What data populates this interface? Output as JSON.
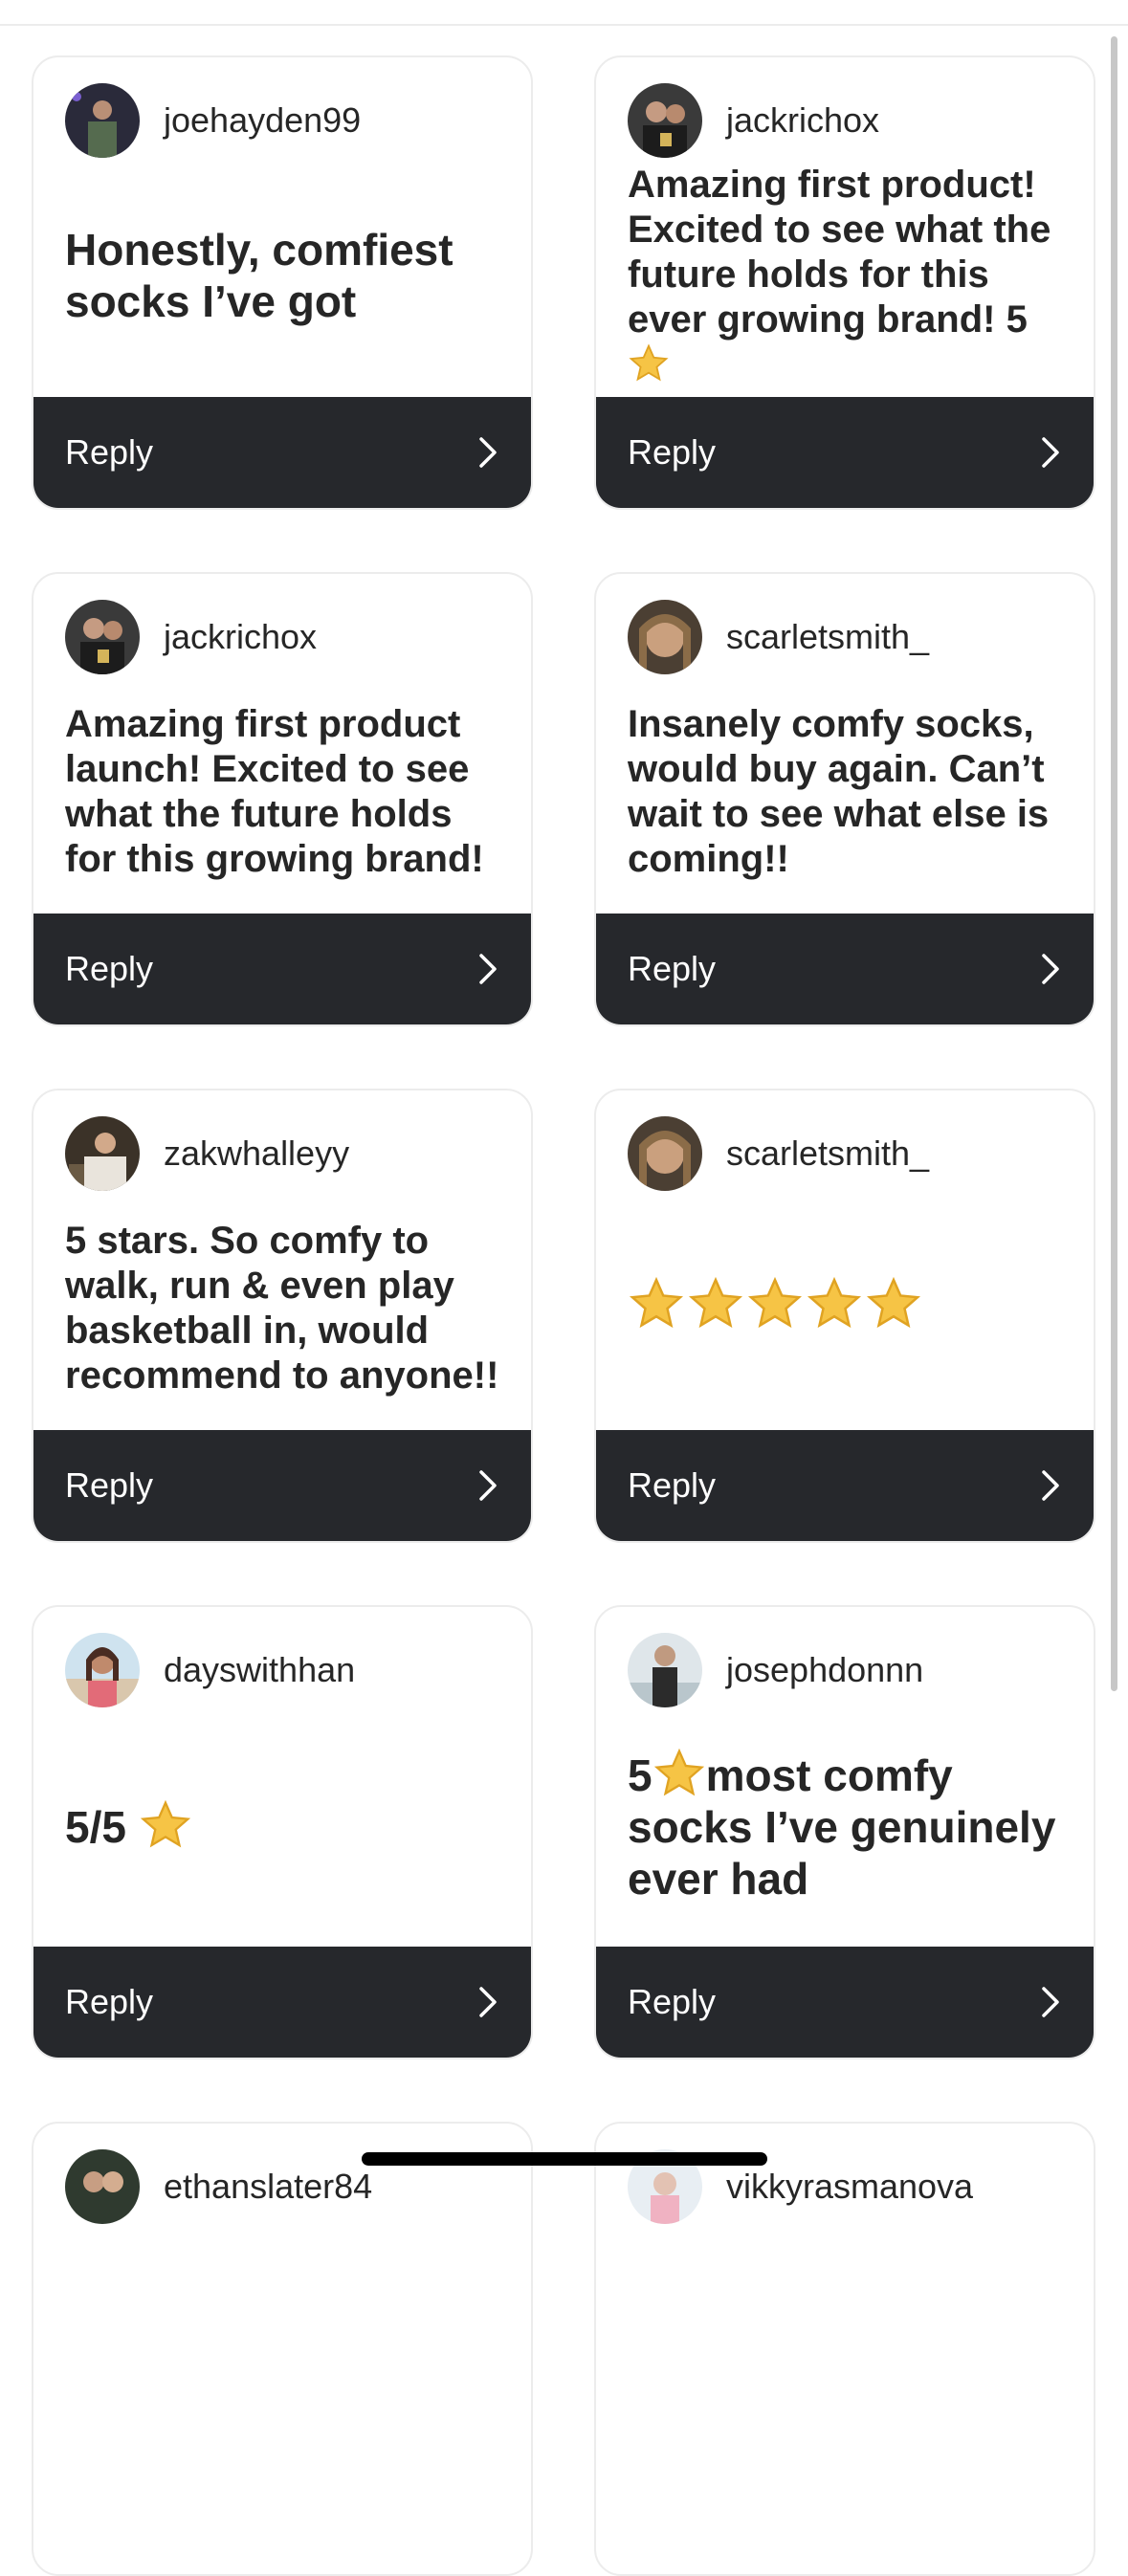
{
  "cards": [
    {
      "username": "joehayden99",
      "text": "Honestly, comfiest socks I’ve got",
      "reply_label": "Reply",
      "avatar": "avatar-photo"
    },
    {
      "username": "jackrichox",
      "text": "Amazing first product! Excited to see what the future holds for this ever growing brand! 5",
      "reply_label": "Reply",
      "avatar": "avatar-photo",
      "trailing_icon": "star-emoji"
    },
    {
      "username": "jackrichox",
      "text": "Amazing first product launch! Excited to see what the future holds for this growing brand!",
      "reply_label": "Reply",
      "avatar": "avatar-photo"
    },
    {
      "username": "scarletsmith_",
      "text": "Insanely comfy socks, would buy again. Can’t wait to see what else is coming!!",
      "reply_label": "Reply",
      "avatar": "avatar-photo"
    },
    {
      "username": "zakwhalleyy",
      "text": "5 stars. So comfy to walk, run & even play basketball in, would recommend to anyone!!",
      "reply_label": "Reply",
      "avatar": "avatar-photo"
    },
    {
      "username": "scarletsmith_",
      "text": "",
      "rating_stars": 5,
      "reply_label": "Reply",
      "avatar": "avatar-photo"
    },
    {
      "username": "dayswithhan",
      "text": "5/5",
      "reply_label": "Reply",
      "avatar": "avatar-photo",
      "trailing_icon": "star-emoji"
    },
    {
      "username": "josephdonnn",
      "text_prefix": "5",
      "text": "most comfy socks I’ve genuinely ever had",
      "reply_label": "Reply",
      "avatar": "avatar-photo"
    },
    {
      "username": "ethanslater84",
      "avatar": "avatar-photo"
    },
    {
      "username": "vikkyrasmanova",
      "avatar": "avatar-photo"
    }
  ],
  "colors": {
    "reply_bar": "#26282c",
    "card_border": "#ececec",
    "text": "#262626",
    "star": "#f6c445"
  }
}
